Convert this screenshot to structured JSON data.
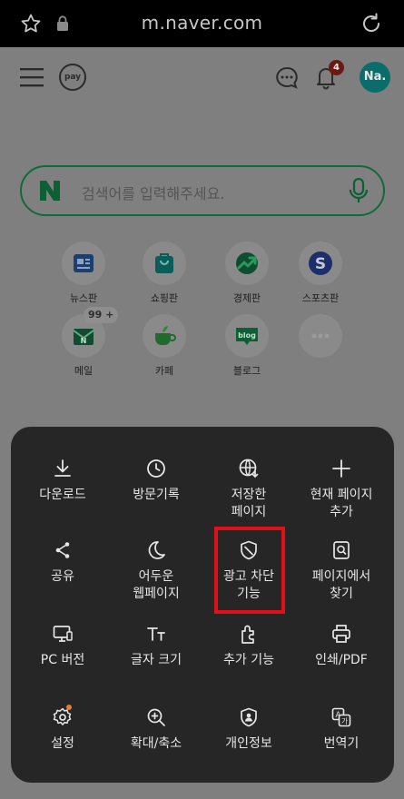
{
  "browser": {
    "url": "m.naver.com"
  },
  "header": {
    "pay_label": "pay",
    "notification_count": "4",
    "avatar_text": "Na."
  },
  "search": {
    "placeholder": "검색어를 입력해주세요."
  },
  "shortcuts": [
    {
      "label": "뉴스판",
      "icon": "news-icon"
    },
    {
      "label": "쇼핑판",
      "icon": "shopping-icon"
    },
    {
      "label": "경제판",
      "icon": "economy-icon"
    },
    {
      "label": "스포츠판",
      "icon": "sports-icon"
    },
    {
      "label": "메일",
      "icon": "mail-icon",
      "badge": "99 +"
    },
    {
      "label": "카페",
      "icon": "cafe-icon"
    },
    {
      "label": "블로그",
      "icon": "blog-icon",
      "icon_text": "blog"
    },
    {
      "label": "",
      "icon": "more-icon"
    }
  ],
  "menu": {
    "items": [
      {
        "label": "다운로드",
        "icon": "download-icon"
      },
      {
        "label": "방문기록",
        "icon": "history-icon"
      },
      {
        "label": "저장한\n페이지",
        "icon": "saved-pages-icon"
      },
      {
        "label": "현재 페이지\n추가",
        "icon": "plus-icon"
      },
      {
        "label": "공유",
        "icon": "share-icon"
      },
      {
        "label": "어두운\n웹페이지",
        "icon": "dark-mode-icon"
      },
      {
        "label": "광고 차단\n기능",
        "icon": "ad-block-shield-icon"
      },
      {
        "label": "페이지에서\n찾기",
        "icon": "find-in-page-icon"
      },
      {
        "label": "PC 버전",
        "icon": "pc-version-icon"
      },
      {
        "label": "글자 크기",
        "icon": "text-size-icon"
      },
      {
        "label": "추가 기능",
        "icon": "add-ons-icon"
      },
      {
        "label": "인쇄/PDF",
        "icon": "print-icon"
      },
      {
        "label": "설정",
        "icon": "settings-icon"
      },
      {
        "label": "확대/축소",
        "icon": "zoom-icon"
      },
      {
        "label": "개인정보",
        "icon": "privacy-icon"
      },
      {
        "label": "번역기",
        "icon": "translate-icon"
      }
    ]
  },
  "colors": {
    "highlight": "#e0101a",
    "sheet_bg": "#262626",
    "naver_green": "#0f6b3e"
  }
}
